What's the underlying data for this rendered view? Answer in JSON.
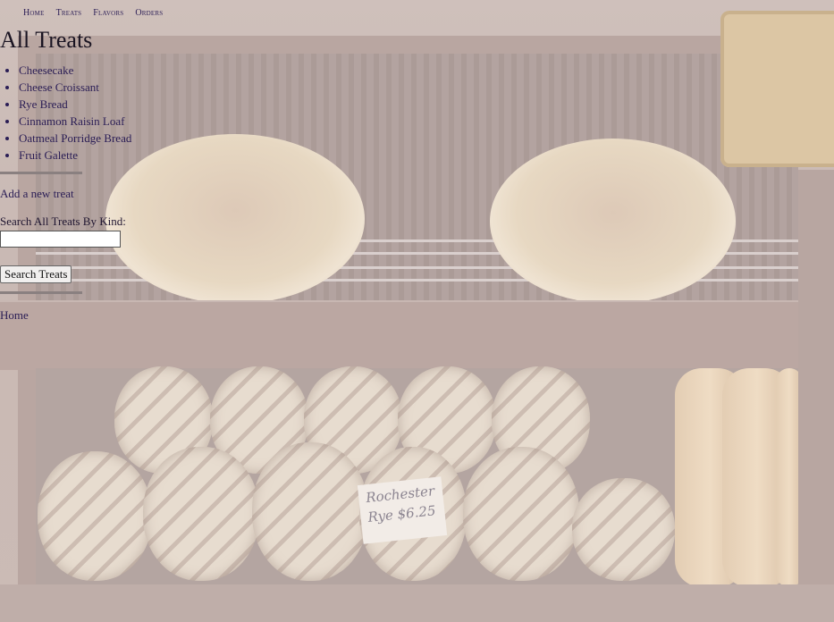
{
  "nav": {
    "items": [
      {
        "label": "Home"
      },
      {
        "label": "Treats"
      },
      {
        "label": "Flavors"
      },
      {
        "label": "Orders"
      }
    ]
  },
  "page": {
    "title": "All Treats"
  },
  "treats": {
    "items": [
      {
        "label": "Cheesecake"
      },
      {
        "label": "Cheese Croissant"
      },
      {
        "label": "Rye Bread"
      },
      {
        "label": "Cinnamon Raisin Loaf"
      },
      {
        "label": "Oatmeal Porridge Bread"
      },
      {
        "label": "Fruit Galette"
      }
    ]
  },
  "actions": {
    "add_new_label": "Add a new treat"
  },
  "search": {
    "label": "Search All Treats By Kind:",
    "value": "",
    "button_label": "Search Treats"
  },
  "footer": {
    "home_label": "Home"
  },
  "background": {
    "price_card_text": "Rochester Rye $6.25"
  }
}
